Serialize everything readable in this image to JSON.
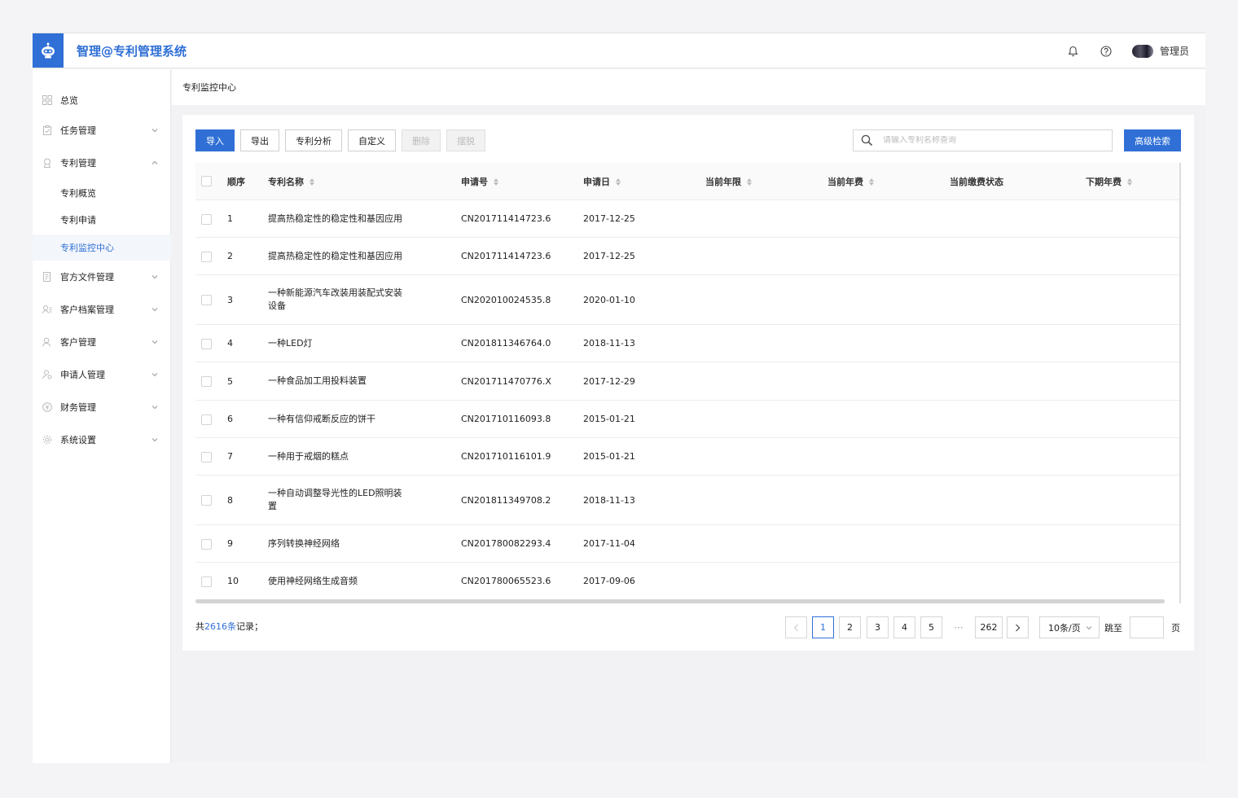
{
  "app": {
    "title": "智理@专利管理系统",
    "user_name": "管理员"
  },
  "sidebar": {
    "items": [
      {
        "label": "总览",
        "icon": "grid-icon",
        "expandable": false
      },
      {
        "label": "任务管理",
        "icon": "clipboard-icon",
        "expandable": true,
        "expanded": false
      },
      {
        "label": "专利管理",
        "icon": "award-icon",
        "expandable": true,
        "expanded": true
      },
      {
        "label": "专利概览",
        "sub": true
      },
      {
        "label": "专利申请",
        "sub": true
      },
      {
        "label": "专利监控中心",
        "sub": true,
        "active": true
      },
      {
        "label": "官方文件管理",
        "icon": "document-icon",
        "expandable": true,
        "expanded": false
      },
      {
        "label": "客户档案管理",
        "icon": "user-list-icon",
        "expandable": true,
        "expanded": false
      },
      {
        "label": "客户管理",
        "icon": "users-icon",
        "expandable": true,
        "expanded": false
      },
      {
        "label": "申请人管理",
        "icon": "user-icon",
        "expandable": true,
        "expanded": false
      },
      {
        "label": "财务管理",
        "icon": "yuan-icon",
        "expandable": true,
        "expanded": false
      },
      {
        "label": "系统设置",
        "icon": "gear-icon",
        "expandable": true,
        "expanded": false
      }
    ]
  },
  "breadcrumb": {
    "current": "专利监控中心"
  },
  "toolbar": {
    "import": "导入",
    "export": "导出",
    "analysis": "专利分析",
    "custom": "自定义",
    "delete": "删除",
    "detach": "摆脱",
    "search_placeholder": "请输入专利名称查询",
    "advanced_search": "高级检索"
  },
  "table": {
    "headers": {
      "index": "顺序",
      "name": "专利名称",
      "app_no": "申请号",
      "app_date": "申请日",
      "current_term": "当前年限",
      "current_fee": "当前年费",
      "fee_status": "当前缴费状态",
      "next_fee": "下期年费"
    },
    "rows": [
      {
        "index": "1",
        "name": "提高热稳定性的稳定性和基因应用",
        "app_no": "CN201711414723.6",
        "app_date": "2017-12-25"
      },
      {
        "index": "2",
        "name": "提高热稳定性的稳定性和基因应用",
        "app_no": "CN201711414723.6",
        "app_date": "2017-12-25"
      },
      {
        "index": "3",
        "name": "一种新能源汽车改装用装配式安装设备",
        "app_no": "CN202010024535.8",
        "app_date": "2020-01-10"
      },
      {
        "index": "4",
        "name": "一种LED灯",
        "app_no": "CN201811346764.0",
        "app_date": "2018-11-13"
      },
      {
        "index": "5",
        "name": "一种食品加工用投料装置",
        "app_no": "CN201711470776.X",
        "app_date": "2017-12-29"
      },
      {
        "index": "6",
        "name": "一种有信仰戒断反应的饼干",
        "app_no": "CN201710116093.8",
        "app_date": "2015-01-21"
      },
      {
        "index": "7",
        "name": "一种用于戒烟的糕点",
        "app_no": "CN201710116101.9",
        "app_date": "2015-01-21"
      },
      {
        "index": "8",
        "name": "一种自动调整导光性的LED照明装置",
        "app_no": "CN201811349708.2",
        "app_date": "2018-11-13"
      },
      {
        "index": "9",
        "name": "序列转换神经网络",
        "app_no": "CN201780082293.4",
        "app_date": "2017-11-04"
      },
      {
        "index": "10",
        "name": "使用神经网络生成音频",
        "app_no": "CN201780065523.6",
        "app_date": "2017-09-06"
      }
    ]
  },
  "footer": {
    "total_prefix": "共",
    "total_count": "2616条",
    "total_suffix": "记录；",
    "pages": [
      "1",
      "2",
      "3",
      "4",
      "5"
    ],
    "ellipsis": "···",
    "last_page": "262",
    "page_size": "10条/页",
    "jump_label": "跳至",
    "page_label": "页"
  }
}
